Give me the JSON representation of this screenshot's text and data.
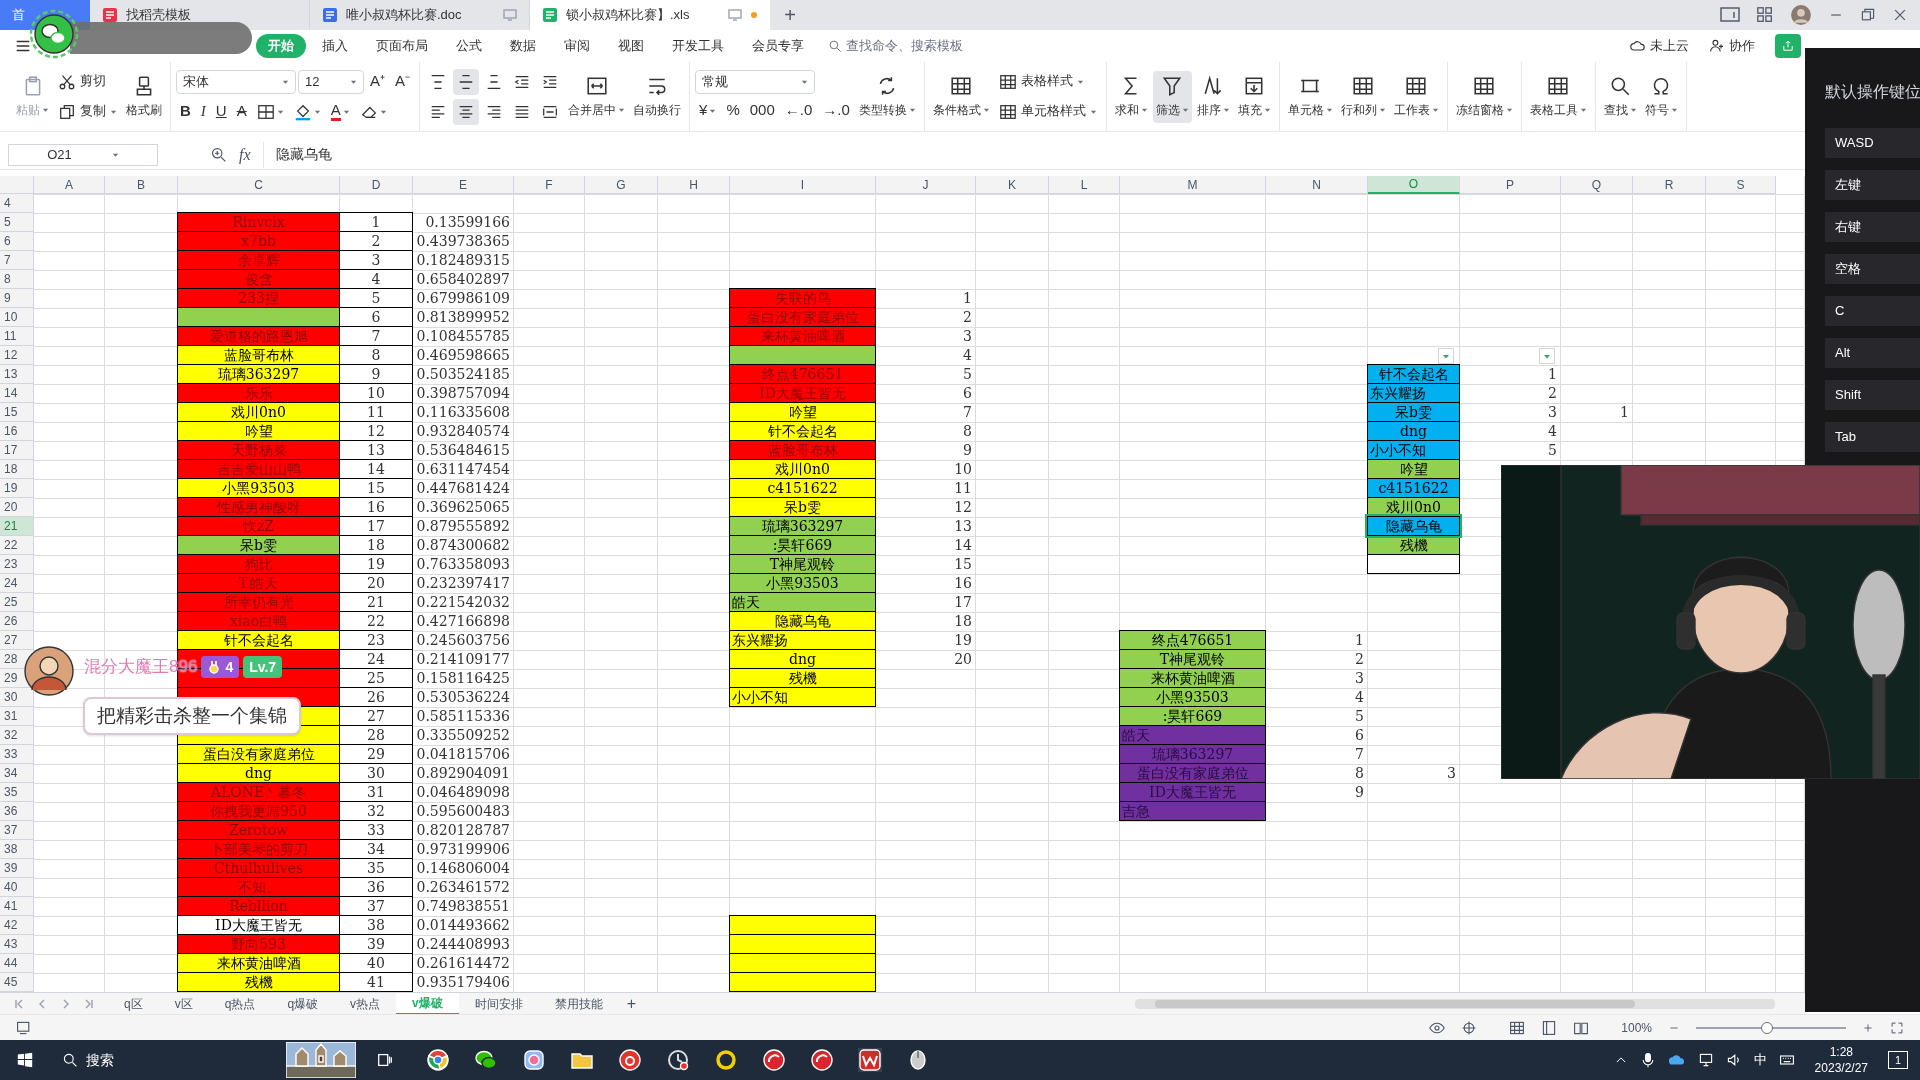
{
  "tabs": [
    {
      "label": "首",
      "kind": "home",
      "selected": false,
      "unsaved": false
    },
    {
      "label": "找稻壳模板",
      "kind": "template",
      "selected": false,
      "unsaved": false
    },
    {
      "label": "唯小叔鸡杯比赛.doc",
      "kind": "doc",
      "selected": false,
      "unsaved": false
    },
    {
      "label": "锁小叔鸡杯比赛】.xls",
      "kind": "sheet",
      "selected": true,
      "unsaved": true
    }
  ],
  "new_tab": "+",
  "menu": [
    {
      "label": "开始",
      "selected": true
    },
    {
      "label": "插入",
      "selected": false
    },
    {
      "label": "页面布局",
      "selected": false
    },
    {
      "label": "公式",
      "selected": false
    },
    {
      "label": "数据",
      "selected": false
    },
    {
      "label": "审阅",
      "selected": false
    },
    {
      "label": "视图",
      "selected": false
    },
    {
      "label": "开发工具",
      "selected": false
    },
    {
      "label": "会员专享",
      "selected": false
    }
  ],
  "command_search": {
    "placeholder": "查找命令、搜索模板"
  },
  "cloud_status": "未上云",
  "collaborate": "协作",
  "ribbon": [
    [
      [
        [
          {
            "kind": "big",
            "label": "粘贴",
            "dropdown": true,
            "disabled": true
          }
        ]
      ],
      [
        [
          {
            "kind": "small",
            "label": "剪切",
            "dropdown": false
          }
        ],
        [
          {
            "kind": "small",
            "label": "复制",
            "dropdown": true
          }
        ]
      ],
      [
        [
          {
            "kind": "big",
            "label": "格式刷",
            "dropdown": false
          }
        ]
      ]
    ],
    [
      [
        [
          {
            "kind": "select",
            "value": "宋体"
          },
          {
            "kind": "select",
            "value": "12"
          },
          {
            "kind": "glyph",
            "label": "A⁺"
          },
          {
            "kind": "glyph",
            "label": "A⁻"
          }
        ],
        [
          {
            "kind": "bold",
            "label": "B"
          },
          {
            "kind": "italic",
            "label": "I"
          },
          {
            "kind": "underline",
            "label": "U"
          },
          {
            "kind": "strike",
            "label": "A"
          },
          {
            "kind": "icon",
            "dropdown": true
          },
          {
            "kind": "icon",
            "dropdown": true
          },
          {
            "kind": "fontcolor",
            "label": "A",
            "dropdown": true
          },
          {
            "kind": "icon",
            "dropdown": true
          }
        ]
      ]
    ],
    [
      [
        [
          {
            "kind": "icon",
            "dropdown": false,
            "on": false
          },
          {
            "kind": "icon",
            "dropdown": false,
            "on": true
          },
          {
            "kind": "icon",
            "dropdown": false,
            "on": false
          },
          {
            "kind": "icon",
            "dropdown": false,
            "on": false
          },
          {
            "kind": "icon",
            "dropdown": false,
            "on": false
          }
        ],
        [
          {
            "kind": "icon",
            "dropdown": false,
            "on": false
          },
          {
            "kind": "icon",
            "dropdown": false,
            "on": true
          },
          {
            "kind": "icon",
            "dropdown": false,
            "on": false
          },
          {
            "kind": "icon",
            "dropdown": false,
            "on": false
          },
          {
            "kind": "icon",
            "dropdown": false,
            "on": false
          }
        ]
      ],
      [
        [
          {
            "kind": "big",
            "label": "合并居中",
            "dropdown": true
          }
        ]
      ],
      [
        [
          {
            "kind": "big",
            "label": "自动换行",
            "dropdown": false
          }
        ]
      ]
    ],
    [
      [
        [
          {
            "kind": "select",
            "value": "常规"
          }
        ],
        [
          {
            "kind": "glyph",
            "label": "¥",
            "dropdown": true
          },
          {
            "kind": "glyph",
            "label": "%"
          },
          {
            "kind": "glyph",
            "label": "000"
          },
          {
            "kind": "glyph",
            "label": "←.0"
          },
          {
            "kind": "glyph",
            "label": "→.0"
          }
        ]
      ],
      [
        [
          {
            "kind": "big",
            "label": "类型转换",
            "dropdown": true
          }
        ]
      ]
    ],
    [
      [
        [
          {
            "kind": "big",
            "label": "条件格式",
            "dropdown": true
          }
        ]
      ],
      [
        [
          {
            "kind": "small",
            "label": "表格样式",
            "dropdown": true
          }
        ],
        [
          {
            "kind": "small",
            "label": "单元格样式",
            "dropdown": true
          }
        ]
      ]
    ],
    [
      [
        [
          {
            "kind": "big",
            "label": "求和",
            "dropdown": true,
            "on": false
          }
        ]
      ],
      [
        [
          {
            "kind": "big",
            "label": "筛选",
            "dropdown": true,
            "on": true
          }
        ]
      ],
      [
        [
          {
            "kind": "big",
            "label": "排序",
            "dropdown": true,
            "on": false
          }
        ]
      ],
      [
        [
          {
            "kind": "big",
            "label": "填充",
            "dropdown": true,
            "on": false
          }
        ]
      ]
    ],
    [
      [
        [
          {
            "kind": "big",
            "label": "单元格",
            "dropdown": true
          }
        ]
      ],
      [
        [
          {
            "kind": "big",
            "label": "行和列",
            "dropdown": true
          }
        ]
      ],
      [
        [
          {
            "kind": "big",
            "label": "工作表",
            "dropdown": true
          }
        ]
      ]
    ],
    [
      [
        [
          {
            "kind": "big",
            "label": "冻结窗格",
            "dropdown": true
          }
        ]
      ]
    ],
    [
      [
        [
          {
            "kind": "big",
            "label": "表格工具",
            "dropdown": true
          }
        ]
      ]
    ],
    [
      [
        [
          {
            "kind": "big",
            "label": "查找",
            "dropdown": true
          }
        ]
      ],
      [
        [
          {
            "kind": "big",
            "label": "符号",
            "dropdown": true
          }
        ]
      ]
    ]
  ],
  "formula_bar": {
    "cell_name": "O21",
    "fx_label": "fx",
    "value": "隐藏乌龟"
  },
  "columns": [
    {
      "label": "A",
      "selected": false
    },
    {
      "label": "B",
      "selected": false
    },
    {
      "label": "C",
      "selected": false
    },
    {
      "label": "D",
      "selected": false
    },
    {
      "label": "E",
      "selected": false
    },
    {
      "label": "F",
      "selected": false
    },
    {
      "label": "G",
      "selected": false
    },
    {
      "label": "H",
      "selected": false
    },
    {
      "label": "I",
      "selected": false
    },
    {
      "label": "J",
      "selected": false
    },
    {
      "label": "K",
      "selected": false
    },
    {
      "label": "L",
      "selected": false
    },
    {
      "label": "M",
      "selected": false
    },
    {
      "label": "N",
      "selected": false
    },
    {
      "label": "O",
      "selected": true
    },
    {
      "label": "P",
      "selected": false
    },
    {
      "label": "Q",
      "selected": false
    },
    {
      "label": "R",
      "selected": false
    },
    {
      "label": "S",
      "selected": false
    }
  ],
  "rows": [
    {
      "number": "4",
      "selected": false
    },
    {
      "number": "5",
      "selected": false,
      "cells": {
        "C": {
          "kind": "label",
          "text": "Rinvcix",
          "color": "#ff0000"
        },
        "D": {
          "kind": "rank",
          "text": "1"
        },
        "E": {
          "kind": "number",
          "text": "0.13599166"
        }
      }
    },
    {
      "number": "6",
      "selected": false,
      "cells": {
        "C": {
          "kind": "label",
          "text": "x7bb",
          "color": "#ff0000"
        },
        "D": {
          "kind": "rank",
          "text": "2"
        },
        "E": {
          "kind": "number",
          "text": "0.439738365"
        }
      }
    },
    {
      "number": "7",
      "selected": false,
      "cells": {
        "C": {
          "kind": "label",
          "text": "余卓辉",
          "color": "#ff0000"
        },
        "D": {
          "kind": "rank",
          "text": "3"
        },
        "E": {
          "kind": "number",
          "text": "0.182489315"
        }
      }
    },
    {
      "number": "8",
      "selected": false,
      "cells": {
        "C": {
          "kind": "label",
          "text": "俊含",
          "color": "#ff0000"
        },
        "D": {
          "kind": "rank",
          "text": "4"
        },
        "E": {
          "kind": "number",
          "text": "0.658402897"
        }
      }
    },
    {
      "number": "9",
      "selected": false,
      "cells": {
        "C": {
          "kind": "label",
          "text": "233捏",
          "color": "#ff0000"
        },
        "D": {
          "kind": "rank",
          "text": "5"
        },
        "E": {
          "kind": "number",
          "text": "0.679986109"
        },
        "I": {
          "kind": "label",
          "text": "失联的鸟",
          "color": "#ff0000"
        },
        "J": {
          "kind": "number",
          "text": "1"
        }
      }
    },
    {
      "number": "10",
      "selected": false,
      "cells": {
        "C": {
          "kind": "label",
          "color": "#92d050"
        },
        "D": {
          "kind": "rank",
          "text": "6"
        },
        "E": {
          "kind": "number",
          "text": "0.813899952"
        },
        "I": {
          "kind": "label",
          "text": "蛋白没有家庭弟位",
          "color": "#ff0000"
        },
        "J": {
          "kind": "number",
          "text": "2"
        }
      }
    },
    {
      "number": "11",
      "selected": false,
      "cells": {
        "C": {
          "kind": "label",
          "text": "爱道格的路恩旭",
          "color": "#ff0000"
        },
        "D": {
          "kind": "rank",
          "text": "7"
        },
        "E": {
          "kind": "number",
          "text": "0.108455785"
        },
        "I": {
          "kind": "label",
          "text": "来杯黄油啤酒",
          "color": "#ff0000"
        },
        "J": {
          "kind": "number",
          "text": "3"
        }
      }
    },
    {
      "number": "12",
      "selected": false,
      "cells": {
        "C": {
          "kind": "label",
          "text": "蓝脸哥布林",
          "color": "#ffff00"
        },
        "D": {
          "kind": "rank",
          "text": "8"
        },
        "E": {
          "kind": "number",
          "text": "0.469598665"
        },
        "I": {
          "kind": "label",
          "color": "#92d050"
        },
        "J": {
          "kind": "number",
          "text": "4"
        },
        "O": {
          "kind": "filter"
        },
        "P": {
          "kind": "filter"
        }
      }
    },
    {
      "number": "13",
      "selected": false,
      "cells": {
        "C": {
          "kind": "label",
          "text": "琉璃363297",
          "color": "#ffff00"
        },
        "D": {
          "kind": "rank",
          "text": "9"
        },
        "E": {
          "kind": "number",
          "text": "0.503524185"
        },
        "I": {
          "kind": "label",
          "text": "终点476651",
          "color": "#ff0000"
        },
        "J": {
          "kind": "number",
          "text": "5"
        },
        "O": {
          "kind": "label",
          "text": "针不会起名",
          "color": "#00b0f0"
        },
        "P": {
          "kind": "number",
          "text": "1"
        }
      }
    },
    {
      "number": "14",
      "selected": false,
      "cells": {
        "C": {
          "kind": "label",
          "text": "乐乐",
          "color": "#ff0000"
        },
        "D": {
          "kind": "rank",
          "text": "10"
        },
        "E": {
          "kind": "number",
          "text": "0.398757094"
        },
        "I": {
          "kind": "label",
          "text": "ID大魔王皆无",
          "color": "#ff0000"
        },
        "J": {
          "kind": "number",
          "text": "6"
        },
        "O": {
          "kind": "leftlabel",
          "text": "东兴耀扬",
          "color": "#00b0f0"
        },
        "P": {
          "kind": "number",
          "text": "2"
        }
      }
    },
    {
      "number": "15",
      "selected": false,
      "cells": {
        "C": {
          "kind": "label",
          "text": "戏川0n0",
          "color": "#ffff00"
        },
        "D": {
          "kind": "rank",
          "text": "11"
        },
        "E": {
          "kind": "number",
          "text": "0.116335608"
        },
        "I": {
          "kind": "label",
          "text": "吟望",
          "color": "#ffff00"
        },
        "J": {
          "kind": "number",
          "text": "7"
        },
        "O": {
          "kind": "label",
          "text": "呆b雯",
          "color": "#00b0f0"
        },
        "P": {
          "kind": "number",
          "text": "3"
        },
        "Q": {
          "kind": "number",
          "text": "1"
        }
      }
    },
    {
      "number": "16",
      "selected": false,
      "cells": {
        "C": {
          "kind": "label",
          "text": "吟望",
          "color": "#ffff00"
        },
        "D": {
          "kind": "rank",
          "text": "12"
        },
        "E": {
          "kind": "number",
          "text": "0.932840574"
        },
        "I": {
          "kind": "label",
          "text": "针不会起名",
          "color": "#ffff00"
        },
        "J": {
          "kind": "number",
          "text": "8"
        },
        "O": {
          "kind": "label",
          "text": "dng",
          "color": "#00b0f0"
        },
        "P": {
          "kind": "number",
          "text": "4"
        }
      }
    },
    {
      "number": "17",
      "selected": false,
      "cells": {
        "C": {
          "kind": "label",
          "text": "天野杨菜",
          "color": "#ff0000"
        },
        "D": {
          "kind": "rank",
          "text": "13"
        },
        "E": {
          "kind": "number",
          "text": "0.536484615"
        },
        "I": {
          "kind": "label",
          "text": "蓝脸哥布林",
          "color": "#ff0000"
        },
        "J": {
          "kind": "number",
          "text": "9"
        },
        "O": {
          "kind": "leftlabel",
          "text": "小小不知",
          "color": "#00b0f0"
        },
        "P": {
          "kind": "number",
          "text": "5"
        }
      }
    },
    {
      "number": "18",
      "selected": false,
      "cells": {
        "C": {
          "kind": "label",
          "text": "吉吉爱山山鸭",
          "color": "#ff0000"
        },
        "D": {
          "kind": "rank",
          "text": "14"
        },
        "E": {
          "kind": "number",
          "text": "0.631147454"
        },
        "I": {
          "kind": "label",
          "text": "戏川0n0",
          "color": "#ffff00"
        },
        "J": {
          "kind": "number",
          "text": "10"
        },
        "O": {
          "kind": "label",
          "text": "吟望",
          "color": "#92d050"
        }
      }
    },
    {
      "number": "19",
      "selected": false,
      "cells": {
        "C": {
          "kind": "label",
          "text": "小黑93503",
          "color": "#ffff00"
        },
        "D": {
          "kind": "rank",
          "text": "15"
        },
        "E": {
          "kind": "number",
          "text": "0.447681424"
        },
        "I": {
          "kind": "label",
          "text": "c4151622",
          "color": "#ffff00"
        },
        "J": {
          "kind": "number",
          "text": "11"
        },
        "O": {
          "kind": "label",
          "text": "c4151622",
          "color": "#00b0f0"
        }
      }
    },
    {
      "number": "20",
      "selected": false,
      "cells": {
        "C": {
          "kind": "label",
          "text": "性感男神酸呀",
          "color": "#ff0000"
        },
        "D": {
          "kind": "rank",
          "text": "16"
        },
        "E": {
          "kind": "number",
          "text": "0.369625065"
        },
        "I": {
          "kind": "label",
          "text": "呆b雯",
          "color": "#ffff00"
        },
        "J": {
          "kind": "number",
          "text": "12"
        },
        "O": {
          "kind": "label",
          "text": "戏川0n0",
          "color": "#92d050"
        }
      }
    },
    {
      "number": "21",
      "selected": true,
      "cells": {
        "C": {
          "kind": "label",
          "text": "忺zZ",
          "color": "#ff0000"
        },
        "D": {
          "kind": "rank",
          "text": "17"
        },
        "E": {
          "kind": "number",
          "text": "0.879555892"
        },
        "I": {
          "kind": "label",
          "text": "琉璃363297",
          "color": "#92d050"
        },
        "J": {
          "kind": "number",
          "text": "13"
        },
        "O": {
          "kind": "label",
          "text": "隐藏乌龟",
          "color": "#00b0f0"
        }
      }
    },
    {
      "number": "22",
      "selected": false,
      "cells": {
        "C": {
          "kind": "label",
          "text": "呆b雯",
          "color": "#92d050"
        },
        "D": {
          "kind": "rank",
          "text": "18"
        },
        "E": {
          "kind": "number",
          "text": "0.874300682"
        },
        "I": {
          "kind": "label",
          "text": ":昊轩669",
          "color": "#92d050"
        },
        "J": {
          "kind": "number",
          "text": "14"
        },
        "O": {
          "kind": "label",
          "text": "残機",
          "color": "#92d050"
        }
      }
    },
    {
      "number": "23",
      "selected": false,
      "cells": {
        "C": {
          "kind": "label",
          "text": "狗比",
          "color": "#ff0000"
        },
        "D": {
          "kind": "rank",
          "text": "19"
        },
        "E": {
          "kind": "number",
          "text": "0.763358093"
        },
        "I": {
          "kind": "label",
          "text": "T神尾观铃",
          "color": "#92d050"
        },
        "J": {
          "kind": "number",
          "text": "15"
        },
        "O": {
          "kind": "label",
          "color": "#ffffff"
        }
      }
    },
    {
      "number": "24",
      "selected": false,
      "cells": {
        "C": {
          "kind": "label",
          "text": "T.皓天",
          "color": "#ff0000"
        },
        "D": {
          "kind": "rank",
          "text": "20"
        },
        "E": {
          "kind": "number",
          "text": "0.232397417"
        },
        "I": {
          "kind": "label",
          "text": "小黑93503",
          "color": "#92d050"
        },
        "J": {
          "kind": "number",
          "text": "16"
        }
      }
    },
    {
      "number": "25",
      "selected": false,
      "cells": {
        "C": {
          "kind": "label",
          "text": "所幸仍有光",
          "color": "#ff0000"
        },
        "D": {
          "kind": "rank",
          "text": "21"
        },
        "E": {
          "kind": "number",
          "text": "0.221542032"
        },
        "I": {
          "kind": "leftlabel",
          "text": "皓天",
          "color": "#92d050"
        },
        "J": {
          "kind": "number",
          "text": "17"
        }
      }
    },
    {
      "number": "26",
      "selected": false,
      "cells": {
        "C": {
          "kind": "label",
          "text": "xiao白鸭",
          "color": "#ff0000"
        },
        "D": {
          "kind": "rank",
          "text": "22"
        },
        "E": {
          "kind": "number",
          "text": "0.427166898"
        },
        "I": {
          "kind": "label",
          "text": "隐藏乌龟",
          "color": "#ffff00"
        },
        "J": {
          "kind": "number",
          "text": "18"
        }
      }
    },
    {
      "number": "27",
      "selected": false,
      "cells": {
        "C": {
          "kind": "label",
          "text": "针不会起名",
          "color": "#ffff00"
        },
        "D": {
          "kind": "rank",
          "text": "23"
        },
        "E": {
          "kind": "number",
          "text": "0.245603756"
        },
        "I": {
          "kind": "leftlabel",
          "text": "东兴耀扬",
          "color": "#ffff00"
        },
        "J": {
          "kind": "number",
          "text": "19"
        },
        "M": {
          "kind": "label",
          "text": "终点476651",
          "color": "#92d050"
        },
        "N": {
          "kind": "number",
          "text": "1"
        }
      }
    },
    {
      "number": "28",
      "selected": false,
      "cells": {
        "C": {
          "kind": "label",
          "color": "#ff0000"
        },
        "D": {
          "kind": "rank",
          "text": "24"
        },
        "E": {
          "kind": "number",
          "text": "0.214109177"
        },
        "I": {
          "kind": "label",
          "text": "dng",
          "color": "#ffff00"
        },
        "J": {
          "kind": "number",
          "text": "20"
        },
        "M": {
          "kind": "label",
          "text": "T神尾观铃",
          "color": "#92d050"
        },
        "N": {
          "kind": "number",
          "text": "2"
        }
      }
    },
    {
      "number": "29",
      "selected": false,
      "cells": {
        "C": {
          "kind": "label",
          "color": "#ff0000"
        },
        "D": {
          "kind": "rank",
          "text": "25"
        },
        "E": {
          "kind": "number",
          "text": "0.158116425"
        },
        "I": {
          "kind": "label",
          "text": "残機",
          "color": "#ffff00"
        },
        "M": {
          "kind": "label",
          "text": "来杯黄油啤酒",
          "color": "#92d050"
        },
        "N": {
          "kind": "number",
          "text": "3"
        }
      }
    },
    {
      "number": "30",
      "selected": false,
      "cells": {
        "C": {
          "kind": "label",
          "color": "#ff0000"
        },
        "D": {
          "kind": "rank",
          "text": "26"
        },
        "E": {
          "kind": "number",
          "text": "0.530536224"
        },
        "I": {
          "kind": "leftlabel",
          "text": "小小不知",
          "color": "#ffff00"
        },
        "M": {
          "kind": "label",
          "text": "小黑93503",
          "color": "#92d050"
        },
        "N": {
          "kind": "number",
          "text": "4"
        }
      }
    },
    {
      "number": "31",
      "selected": false,
      "cells": {
        "C": {
          "kind": "label",
          "color": "#ffff00"
        },
        "D": {
          "kind": "rank",
          "text": "27"
        },
        "E": {
          "kind": "number",
          "text": "0.585115336"
        },
        "M": {
          "kind": "label",
          "text": ":昊轩669",
          "color": "#92d050"
        },
        "N": {
          "kind": "number",
          "text": "5"
        }
      }
    },
    {
      "number": "32",
      "selected": false,
      "cells": {
        "C": {
          "kind": "label",
          "color": "#ffff00"
        },
        "D": {
          "kind": "rank",
          "text": "28"
        },
        "E": {
          "kind": "number",
          "text": "0.335509252"
        },
        "M": {
          "kind": "leftlabel",
          "text": "皓天",
          "color": "#7030a0"
        },
        "N": {
          "kind": "number",
          "text": "6"
        }
      }
    },
    {
      "number": "33",
      "selected": false,
      "cells": {
        "C": {
          "kind": "label",
          "text": "蛋白没有家庭弟位",
          "color": "#ffff00"
        },
        "D": {
          "kind": "rank",
          "text": "29"
        },
        "E": {
          "kind": "number",
          "text": "0.041815706"
        },
        "M": {
          "kind": "label",
          "text": "琉璃363297",
          "color": "#7030a0"
        },
        "N": {
          "kind": "number",
          "text": "7"
        }
      }
    },
    {
      "number": "34",
      "selected": false,
      "cells": {
        "C": {
          "kind": "label",
          "text": "dng",
          "color": "#ffff00"
        },
        "D": {
          "kind": "rank",
          "text": "30"
        },
        "E": {
          "kind": "number",
          "text": "0.892904091"
        },
        "M": {
          "kind": "label",
          "text": "蛋白没有家庭弟位",
          "color": "#7030a0"
        },
        "N": {
          "kind": "number",
          "text": "8"
        },
        "O": {
          "kind": "number",
          "text": "3"
        }
      }
    },
    {
      "number": "35",
      "selected": false,
      "cells": {
        "C": {
          "kind": "label",
          "text": "ALONE丶暮冬",
          "color": "#ff0000"
        },
        "D": {
          "kind": "rank",
          "text": "31"
        },
        "E": {
          "kind": "number",
          "text": "0.046489098"
        },
        "M": {
          "kind": "label",
          "text": "ID大魔王皆无",
          "color": "#7030a0"
        },
        "N": {
          "kind": "number",
          "text": "9"
        }
      }
    },
    {
      "number": "36",
      "selected": false,
      "cells": {
        "C": {
          "kind": "label",
          "text": "你拽我更屌950",
          "color": "#ff0000"
        },
        "D": {
          "kind": "rank",
          "text": "32"
        },
        "E": {
          "kind": "number",
          "text": "0.595600483"
        },
        "M": {
          "kind": "leftlabel",
          "text": "吉急",
          "color": "#7030a0"
        }
      }
    },
    {
      "number": "37",
      "selected": false,
      "cells": {
        "C": {
          "kind": "label",
          "text": "Zerotow",
          "color": "#ff0000"
        },
        "D": {
          "kind": "rank",
          "text": "33"
        },
        "E": {
          "kind": "number",
          "text": "0.820128787"
        }
      }
    },
    {
      "number": "38",
      "selected": false,
      "cells": {
        "C": {
          "kind": "label",
          "text": "卜部美琴的剪刀",
          "color": "#ff0000"
        },
        "D": {
          "kind": "rank",
          "text": "34"
        },
        "E": {
          "kind": "number",
          "text": "0.973199906"
        }
      }
    },
    {
      "number": "39",
      "selected": false,
      "cells": {
        "C": {
          "kind": "label",
          "text": "Cthulhulives",
          "color": "#ff0000"
        },
        "D": {
          "kind": "rank",
          "text": "35"
        },
        "E": {
          "kind": "number",
          "text": "0.146806004"
        }
      }
    },
    {
      "number": "40",
      "selected": false,
      "cells": {
        "C": {
          "kind": "label",
          "text": "不知、",
          "color": "#ff0000"
        },
        "D": {
          "kind": "rank",
          "text": "36"
        },
        "E": {
          "kind": "number",
          "text": "0.263461572"
        }
      }
    },
    {
      "number": "41",
      "selected": false,
      "cells": {
        "C": {
          "kind": "label",
          "text": "Rebllion",
          "color": "#ff0000"
        },
        "D": {
          "kind": "rank",
          "text": "37"
        },
        "E": {
          "kind": "number",
          "text": "0.749838551"
        }
      }
    },
    {
      "number": "42",
      "selected": false,
      "cells": {
        "C": {
          "kind": "label",
          "text": "ID大魔王皆无",
          "color": "#ffffff"
        },
        "D": {
          "kind": "rank",
          "text": "38"
        },
        "E": {
          "kind": "number",
          "text": "0.014493662"
        },
        "I": {
          "kind": "label",
          "color": "#ffff00"
        }
      }
    },
    {
      "number": "43",
      "selected": false,
      "cells": {
        "C": {
          "kind": "label",
          "text": "野向593",
          "color": "#ff0000"
        },
        "D": {
          "kind": "rank",
          "text": "39"
        },
        "E": {
          "kind": "number",
          "text": "0.244408993"
        },
        "I": {
          "kind": "label",
          "color": "#ffff00"
        }
      }
    },
    {
      "number": "44",
      "selected": false,
      "cells": {
        "C": {
          "kind": "label",
          "text": "来杯黄油啤酒",
          "color": "#ffff00"
        },
        "D": {
          "kind": "rank",
          "text": "40"
        },
        "E": {
          "kind": "number",
          "text": "0.261614472"
        },
        "I": {
          "kind": "label",
          "color": "#ffff00"
        }
      }
    },
    {
      "number": "45",
      "selected": false,
      "cells": {
        "C": {
          "kind": "label",
          "text": "残機",
          "color": "#ffff00"
        },
        "D": {
          "kind": "rank",
          "text": "41"
        },
        "E": {
          "kind": "number",
          "text": "0.935179406"
        },
        "I": {
          "kind": "label",
          "color": "#ffff00"
        }
      }
    }
  ],
  "sheet_tabs": [
    {
      "label": "q区",
      "selected": false
    },
    {
      "label": "v区",
      "selected": false
    },
    {
      "label": "q热点",
      "selected": false
    },
    {
      "label": "q爆破",
      "selected": false
    },
    {
      "label": "v热点",
      "selected": false
    },
    {
      "label": "v爆破",
      "selected": true
    },
    {
      "label": "时间安排",
      "selected": false
    },
    {
      "label": "禁用技能",
      "selected": false
    }
  ],
  "add_sheet": "+",
  "status_bar": {
    "zoom": "100%",
    "zoom_slider": {
      "level": 0.47
    }
  },
  "key_panel": {
    "title": "默认操作键位",
    "keys": [
      "WASD",
      "左键",
      "右键",
      "空格",
      "C",
      "Alt",
      "Shift",
      "Tab"
    ]
  },
  "stream_overlay": {
    "viewer": "混分大魔王896",
    "badge": "4",
    "level_badge": "Lv.7",
    "comment": "把精彩击杀整一个集锦"
  },
  "taskbar": {
    "search_placeholder": "搜索",
    "input_method": "中",
    "time": "1:28",
    "date": "2023/2/27",
    "notifications": "1"
  }
}
